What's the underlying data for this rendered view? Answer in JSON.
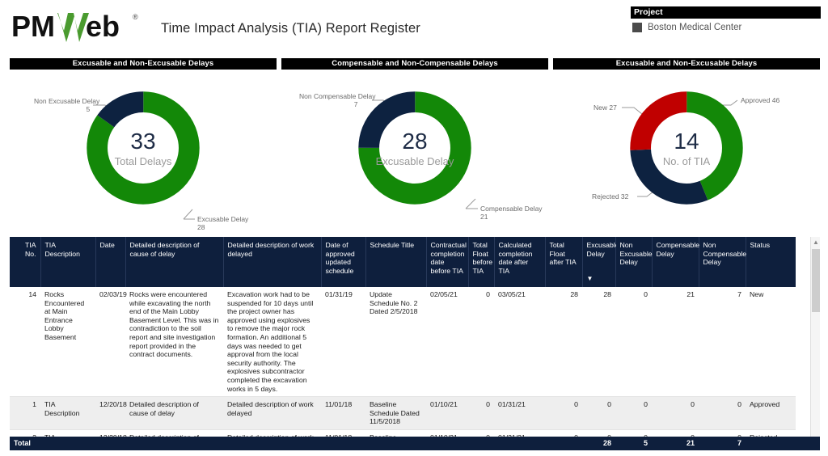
{
  "header": {
    "logo_text": "PMWeb",
    "logo_trademark": "®",
    "report_title": "Time Impact Analysis (TIA) Report Register"
  },
  "slicer": {
    "title": "Project",
    "items": [
      {
        "label": "Boston Medical Center",
        "checked": true
      }
    ]
  },
  "colors": {
    "green": "#138808",
    "navy": "#0d2240",
    "red": "#c00000",
    "header_bg": "#0e1f3d",
    "title_bg": "#000000"
  },
  "chart_data": [
    {
      "type": "pie",
      "title": "Excusable and Non-Excusable Delays",
      "center_value": "33",
      "center_label": "Total Delays",
      "categories": [
        "Excusable Delay",
        "Non Excusable Delay"
      ],
      "values": [
        28,
        5
      ],
      "colors": [
        "#138808",
        "#0d2240"
      ],
      "labels": [
        {
          "name": "Non Excusable Delay",
          "value": "5"
        },
        {
          "name": "Excusable Delay",
          "value": "28"
        }
      ],
      "legend": "callout"
    },
    {
      "type": "pie",
      "title": "Compensable and Non-Compensable Delays",
      "center_value": "28",
      "center_label": "Excusable Delay",
      "categories": [
        "Compensable Delay",
        "Non Compensable Delay"
      ],
      "values": [
        21,
        7
      ],
      "colors": [
        "#138808",
        "#0d2240"
      ],
      "labels": [
        {
          "name": "Non Compensable Delay",
          "value": "7"
        },
        {
          "name": "Compensable Delay",
          "value": "21"
        }
      ],
      "legend": "callout"
    },
    {
      "type": "pie",
      "title": "Excusable and Non-Excusable Delays",
      "center_value": "14",
      "center_label": "No. of TIA",
      "categories": [
        "Approved",
        "Rejected",
        "New"
      ],
      "values": [
        46,
        32,
        27
      ],
      "colors": [
        "#138808",
        "#0d2240",
        "#c00000"
      ],
      "labels": [
        {
          "name": "Approved 46"
        },
        {
          "name": "Rejected 32"
        },
        {
          "name": "New 27"
        }
      ],
      "legend": "callout"
    }
  ],
  "table": {
    "columns": [
      "TIA No.",
      "TIA Description",
      "Date",
      "Detailed description of cause of delay",
      "Detailed description of work delayed",
      "Date of approved updated schedule",
      "Schedule Title",
      "Contractual completion date before TIA",
      "Total Float before TIA",
      "Calculated completion date after TIA",
      "Total Float after TIA",
      "Excusable Delay",
      "Non Excusable Delay",
      "Compensable Delay",
      "Non Compensable Delay",
      "Status"
    ],
    "sorted_column": "Excusable Delay",
    "sort_indicator": "▼",
    "rows": [
      {
        "tia_no": "14",
        "tia_description": "Rocks Encountered at Main Entrance Lobby Basement",
        "date": "02/03/19",
        "cause_of_delay": "Rocks were encountered while excavating the north end of the Main Lobby Basement Level. This was in contradiction to the soil report and site investigation report provided in the contract documents.",
        "work_delayed": "Excavation work had to be suspended for 10 days until the project owner has approved using explosives to remove the major rock formation. An additional 5 days was needed to get approval from the local security authority. The explosives subcontractor completed the excavation works in 5 days.",
        "date_approved_schedule": "01/31/19",
        "schedule_title": "Update Schedule No. 2 Dated 2/5/2018",
        "contractual_completion_before": "02/05/21",
        "total_float_before": "0",
        "calculated_completion_after": "03/05/21",
        "total_float_after": "28",
        "excusable_delay": "28",
        "non_excusable_delay": "0",
        "compensable_delay": "21",
        "non_compensable_delay": "7",
        "status": "New"
      },
      {
        "tia_no": "1",
        "tia_description": "TIA Description",
        "date": "12/20/18",
        "cause_of_delay": "Detailed description of cause of delay",
        "work_delayed": "Detailed description of work delayed",
        "date_approved_schedule": "11/01/18",
        "schedule_title": "Baseline Schedule Dated 11/5/2018",
        "contractual_completion_before": "01/10/21",
        "total_float_before": "0",
        "calculated_completion_after": "01/31/21",
        "total_float_after": "0",
        "excusable_delay": "0",
        "non_excusable_delay": "0",
        "compensable_delay": "0",
        "non_compensable_delay": "0",
        "status": "Approved"
      },
      {
        "tia_no": "2",
        "tia_description": "TIA Description",
        "date": "12/20/18",
        "cause_of_delay": "Detailed description of",
        "work_delayed": "Detailed description of work",
        "date_approved_schedule": "11/01/18",
        "schedule_title": "Baseline Schedule",
        "contractual_completion_before": "01/10/21",
        "total_float_before": "0",
        "calculated_completion_after": "01/31/21",
        "total_float_after": "0",
        "excusable_delay": "0",
        "non_excusable_delay": "0",
        "compensable_delay": "0",
        "non_compensable_delay": "0",
        "status": "Rejected"
      }
    ],
    "total_row": {
      "label": "Total",
      "total_float_after": "",
      "excusable_delay": "28",
      "non_excusable_delay": "5",
      "compensable_delay": "21",
      "non_compensable_delay": "7",
      "status": ""
    }
  }
}
